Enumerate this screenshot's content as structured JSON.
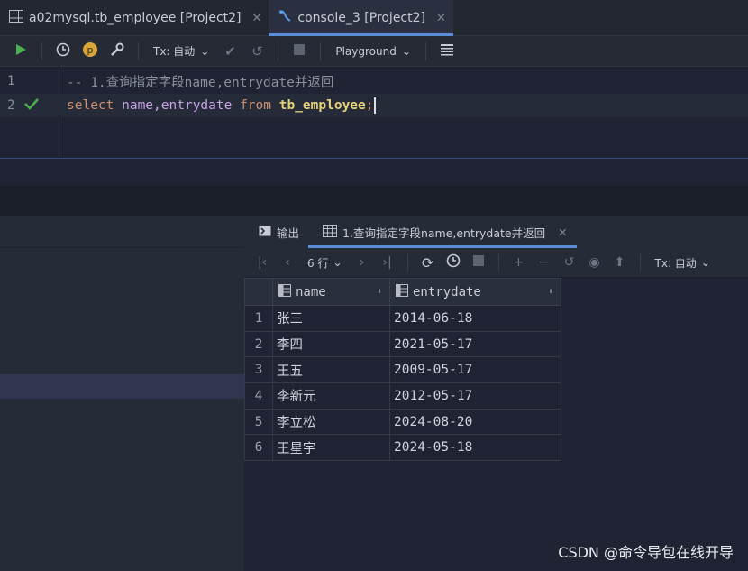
{
  "tabs": [
    {
      "label": "a02mysql.tb_employee [Project2]",
      "icon": "table-icon"
    },
    {
      "label": "console_3 [Project2]",
      "icon": "console-icon"
    }
  ],
  "toolbar": {
    "tx_label": "Tx: 自动",
    "playground_label": "Playground"
  },
  "editor": {
    "line1_no": "1",
    "line2_no": "2",
    "comment": "-- 1.查询指定字段name,entrydate并返回",
    "select_kw": "select",
    "columns": " name,entrydate ",
    "from_kw": "from",
    "table": " tb_employee",
    "semicolon": ";"
  },
  "results": {
    "tab_output": "输出",
    "tab_result": "1.查询指定字段name,entrydate并返回",
    "rows_label": "6 行",
    "tx_label": "Tx: 自动",
    "columns": [
      "name",
      "entrydate"
    ],
    "rows": [
      {
        "n": "1",
        "name": "张三",
        "date": "2014-06-18"
      },
      {
        "n": "2",
        "name": "李四",
        "date": "2021-05-17"
      },
      {
        "n": "3",
        "name": "王五",
        "date": "2009-05-17"
      },
      {
        "n": "4",
        "name": "李新元",
        "date": "2012-05-17"
      },
      {
        "n": "5",
        "name": "李立松",
        "date": "2024-08-20"
      },
      {
        "n": "6",
        "name": "王星宇",
        "date": "2024-05-18"
      }
    ]
  },
  "watermark": "CSDN @命令导包在线开导",
  "colors": {
    "accent": "#5b8cd6",
    "run": "#4caf50",
    "keyword": "#cf8e6d",
    "table": "#e6d37a"
  }
}
